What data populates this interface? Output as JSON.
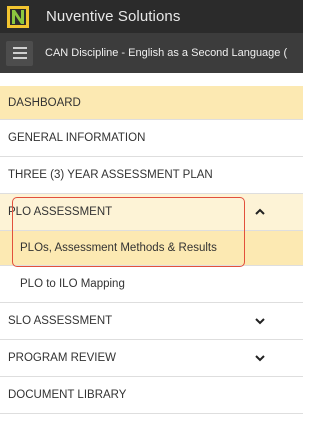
{
  "app": {
    "title": "Nuventive Solutions"
  },
  "subbar": {
    "title": "CAN Discipline - English as a Second Language ("
  },
  "nav": {
    "items": [
      {
        "label": "DASHBOARD"
      },
      {
        "label": "GENERAL INFORMATION"
      },
      {
        "label": "THREE (3) YEAR ASSESSMENT PLAN"
      },
      {
        "label": "PLO ASSESSMENT"
      },
      {
        "label": "PLOs, Assessment Methods & Results"
      },
      {
        "label": "PLO to ILO Mapping"
      },
      {
        "label": "SLO ASSESSMENT"
      },
      {
        "label": "PROGRAM REVIEW"
      },
      {
        "label": "DOCUMENT LIBRARY"
      }
    ]
  },
  "colors": {
    "topbar": "#2b2b2b",
    "subbar": "#3c3c3c",
    "active_bg": "#fce9b2",
    "highlight_border": "#e2503c",
    "logo_green": "#8cc63f",
    "logo_yellow": "#f2c430"
  },
  "icons": {
    "logo": "nuventive-logo-icon",
    "menu": "hamburger-icon",
    "expanded": "chevron-up-icon",
    "collapsed": "chevron-down-icon"
  }
}
